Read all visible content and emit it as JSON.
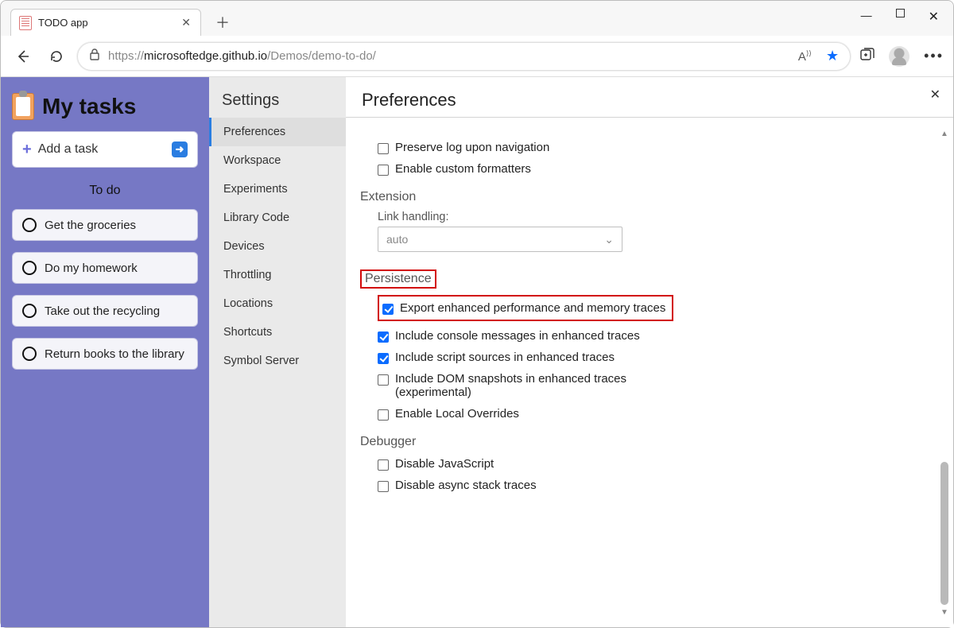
{
  "tab": {
    "title": "TODO app"
  },
  "url": {
    "visible_prefix": "https://",
    "visible_host": "microsoftedge.github.io",
    "visible_path": "/Demos/demo-to-do/"
  },
  "app": {
    "title": "My tasks",
    "add_task_label": "Add a task",
    "todo_header": "To do",
    "tasks": [
      {
        "label": "Get the groceries"
      },
      {
        "label": "Do my homework"
      },
      {
        "label": "Take out the recycling"
      },
      {
        "label": "Return books to the library"
      }
    ]
  },
  "settings": {
    "title": "Settings",
    "items": [
      {
        "label": "Preferences",
        "active": true
      },
      {
        "label": "Workspace"
      },
      {
        "label": "Experiments"
      },
      {
        "label": "Library Code"
      },
      {
        "label": "Devices"
      },
      {
        "label": "Throttling"
      },
      {
        "label": "Locations"
      },
      {
        "label": "Shortcuts"
      },
      {
        "label": "Symbol Server"
      }
    ]
  },
  "pref": {
    "title": "Preferences",
    "r_preserve_log": "Preserve log upon navigation",
    "r_custom_formatters": "Enable custom formatters",
    "section_extension": "Extension",
    "link_handling_label": "Link handling:",
    "link_handling_value": "auto",
    "section_persistence": "Persistence",
    "r_export_enh": "Export enhanced performance and memory traces",
    "r_console_msgs": "Include console messages in enhanced traces",
    "r_script_src": "Include script sources in enhanced traces",
    "r_dom_snap": "Include DOM snapshots in enhanced traces (experimental)",
    "r_local_over": "Enable Local Overrides",
    "section_debugger": "Debugger",
    "r_disable_js": "Disable JavaScript",
    "r_disable_async": "Disable async stack traces"
  }
}
